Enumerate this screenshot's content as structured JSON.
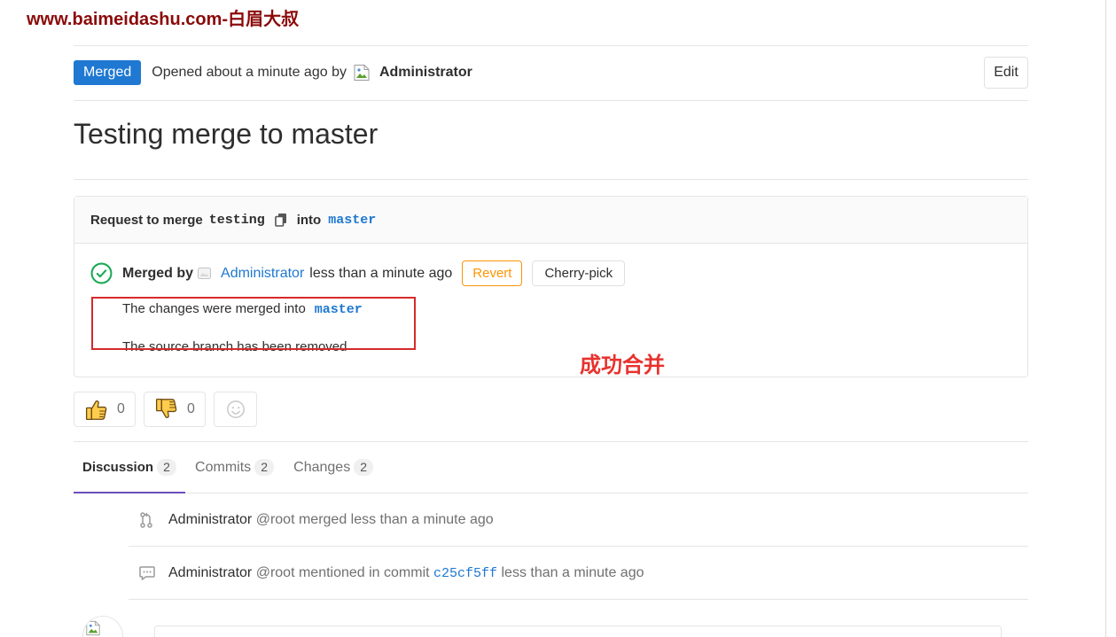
{
  "watermark": "www.baimeidashu.com-白眉大叔",
  "header": {
    "status_badge": "Merged",
    "opened_text": "Opened about a minute ago by",
    "avatar_icon": "broken-image-icon",
    "author": "Administrator",
    "edit_label": "Edit"
  },
  "title": "Testing merge to master",
  "merge_widget": {
    "request_label": "Request to merge",
    "source_branch": "testing",
    "copy_icon": "copy-icon",
    "into_label": "into",
    "target_branch": "master",
    "status_icon": "check-circle-icon",
    "merged_by_label": "Merged by",
    "merged_by_user": "Administrator",
    "merged_time": "less than a minute ago",
    "revert_label": "Revert",
    "cherry_pick_label": "Cherry-pick",
    "merged_into_text": "The changes were merged into",
    "merged_into_branch": "master",
    "source_removed_text": "The source branch has been removed"
  },
  "annotation": {
    "text": "成功合并"
  },
  "awards": [
    {
      "icon": "thumbsup-icon",
      "count": "0"
    },
    {
      "icon": "thumbsdown-icon",
      "count": "0"
    },
    {
      "icon": "smiley-icon"
    }
  ],
  "tabs": [
    {
      "label": "Discussion",
      "count": "2",
      "active": true
    },
    {
      "label": "Commits",
      "count": "2",
      "active": false
    },
    {
      "label": "Changes",
      "count": "2",
      "active": false
    }
  ],
  "timeline": [
    {
      "icon": "merge-icon",
      "author": "Administrator",
      "action": "@root merged less than a minute ago"
    },
    {
      "icon": "comment-icon",
      "author": "Administrator",
      "action": "@root mentioned in commit",
      "commit": "c25cf5ff",
      "time": "less than a minute ago"
    }
  ],
  "colors": {
    "accent": "#1f78d1",
    "success": "#1aaa55",
    "warning": "#fc9403",
    "annotation": "#d62a2a",
    "watermark": "#8b0a0a",
    "active_tab": "#6b4fbb"
  }
}
